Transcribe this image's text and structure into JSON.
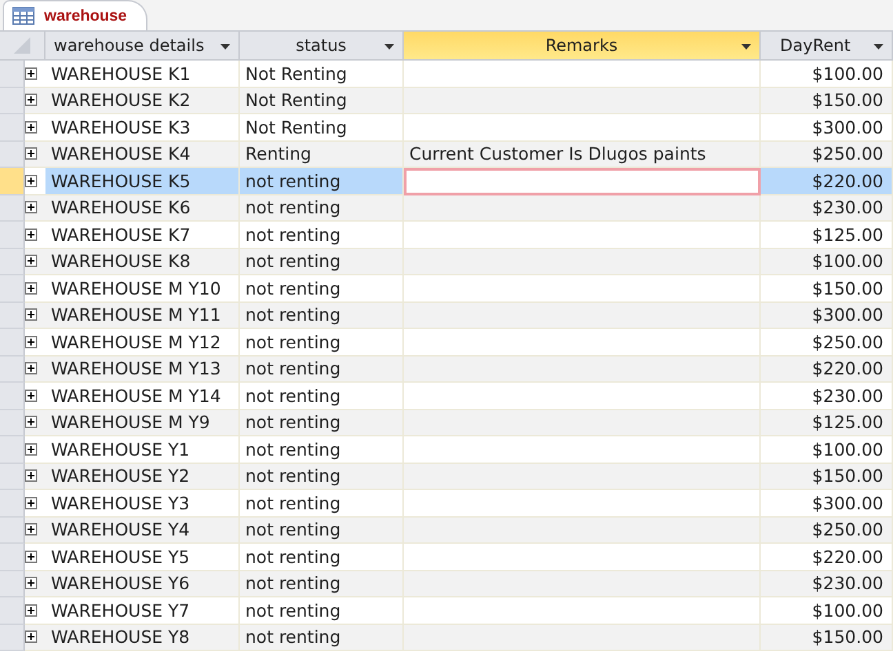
{
  "tabs": [
    {
      "label": "warehouse",
      "selected": true
    }
  ],
  "table": {
    "columns": [
      {
        "label": "warehouse details",
        "selected": false
      },
      {
        "label": "status",
        "selected": false
      },
      {
        "label": "Remarks",
        "selected": true
      },
      {
        "label": "DayRent",
        "selected": false
      }
    ],
    "rows": [
      {
        "details": "WAREHOUSE K1",
        "status": "Not Renting",
        "rent": "$100.00",
        "selected": false
      },
      {
        "details": "WAREHOUSE K2",
        "status": "Not Renting",
        "rent": "$150.00",
        "selected": false
      },
      {
        "details": "WAREHOUSE K3",
        "status": "Not Renting",
        "rent": "$300.00",
        "selected": false
      },
      {
        "details": "WAREHOUSE K4",
        "status": "Renting",
        "remarks": "Current Customer Is Dlugos paints",
        "rent": "$250.00",
        "selected": false
      },
      {
        "details": "WAREHOUSE K5",
        "status": "not renting",
        "rent": "$220.00",
        "selected": true
      },
      {
        "details": "WAREHOUSE K6",
        "status": "not renting",
        "rent": "$230.00",
        "selected": false
      },
      {
        "details": "WAREHOUSE K7",
        "status": "not renting",
        "rent": "$125.00",
        "selected": false
      },
      {
        "details": "WAREHOUSE K8",
        "status": "not renting",
        "rent": "$100.00",
        "selected": false
      },
      {
        "details": "WAREHOUSE M Y10",
        "status": "not renting",
        "rent": "$150.00",
        "selected": false
      },
      {
        "details": "WAREHOUSE M Y11",
        "status": "not renting",
        "rent": "$300.00",
        "selected": false
      },
      {
        "details": "WAREHOUSE M Y12",
        "status": "not renting",
        "rent": "$250.00",
        "selected": false
      },
      {
        "details": "WAREHOUSE M Y13",
        "status": "not renting",
        "rent": "$220.00",
        "selected": false
      },
      {
        "details": "WAREHOUSE M Y14",
        "status": "not renting",
        "rent": "$230.00",
        "selected": false
      },
      {
        "details": "WAREHOUSE M Y9",
        "status": "not renting",
        "rent": "$125.00",
        "selected": false
      },
      {
        "details": "WAREHOUSE Y1",
        "status": "not renting",
        "rent": "$100.00",
        "selected": false
      },
      {
        "details": "WAREHOUSE Y2",
        "status": "not renting",
        "rent": "$150.00",
        "selected": false
      },
      {
        "details": "WAREHOUSE Y3",
        "status": "not renting",
        "rent": "$300.00",
        "selected": false
      },
      {
        "details": "WAREHOUSE Y4",
        "status": "not renting",
        "rent": "$250.00",
        "selected": false
      },
      {
        "details": "WAREHOUSE Y5",
        "status": "not renting",
        "rent": "$220.00",
        "selected": false
      },
      {
        "details": "WAREHOUSE Y6",
        "status": "not renting",
        "rent": "$230.00",
        "selected": false
      },
      {
        "details": "WAREHOUSE Y7",
        "status": "not renting",
        "rent": "$100.00",
        "selected": false
      },
      {
        "details": "WAREHOUSE Y8",
        "status": "not renting",
        "rent": "$150.00",
        "selected": false
      }
    ]
  }
}
